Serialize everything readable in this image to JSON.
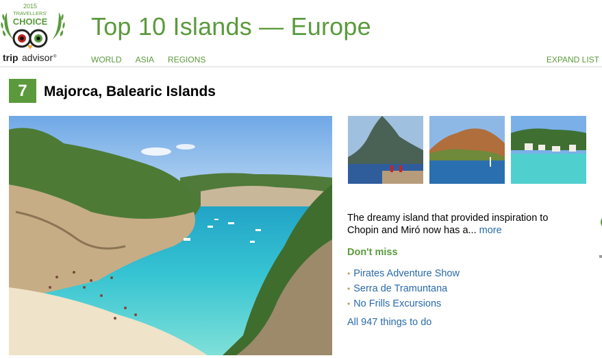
{
  "badge": {
    "year": "2015",
    "line1": "TRAVELLERS'",
    "line2": "CHOICE",
    "brand_trip": "trip",
    "brand_advisor": "advisor",
    "trademark": "®"
  },
  "header": {
    "title": "Top 10 Islands — Europe",
    "nav": [
      "WORLD",
      "ASIA",
      "REGIONS"
    ],
    "expand_label": "EXPAND LIST"
  },
  "entry": {
    "rank": "7",
    "name": "Majorca, Balearic Islands",
    "description": "The dreamy island that provided inspiration to Chopin and Miró now has a...",
    "more_label": "more",
    "dont_miss_label": "Don't miss",
    "dont_miss_items": [
      "Pirates Adventure Show",
      "Serra de Tramuntana",
      "No Frills Excursions"
    ],
    "all_things_label": "All 947 things to do"
  },
  "colors": {
    "brand_green": "#5a9a3c",
    "link_blue": "#2a6aa8",
    "bullet_gold": "#b5a35a"
  }
}
